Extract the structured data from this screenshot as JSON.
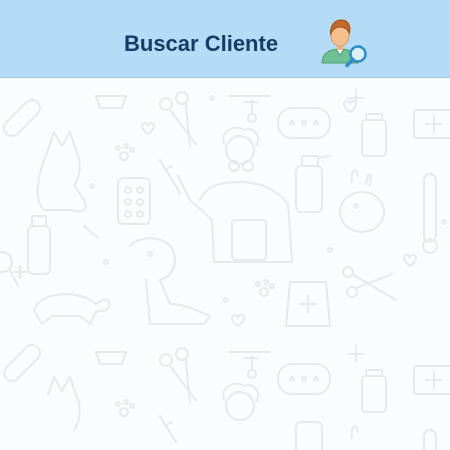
{
  "header": {
    "title": "Buscar Cliente",
    "icon": "customer-search-icon"
  },
  "background": {
    "pattern": "veterinary-doodle-pattern",
    "icons": [
      "bandage-icon",
      "cat-icon",
      "bowl-icon",
      "scissors-icon",
      "bone-icon",
      "chat-bubble-icon",
      "medical-cross-icon",
      "jar-icon",
      "first-aid-kit-icon",
      "paw-icon",
      "syringe-icon",
      "pill-blister-icon",
      "veterinarian-illustration",
      "dog-icon",
      "spray-bottle-icon",
      "rabbit-icon",
      "thermometer-icon",
      "turtle-icon",
      "clipboard-icon",
      "pet-food-bag-icon",
      "forceps-icon",
      "heart-icon"
    ]
  },
  "colors": {
    "header_bg": "#b5dcf6",
    "title": "#173c64",
    "pattern_stroke": "#e6e9ee"
  }
}
